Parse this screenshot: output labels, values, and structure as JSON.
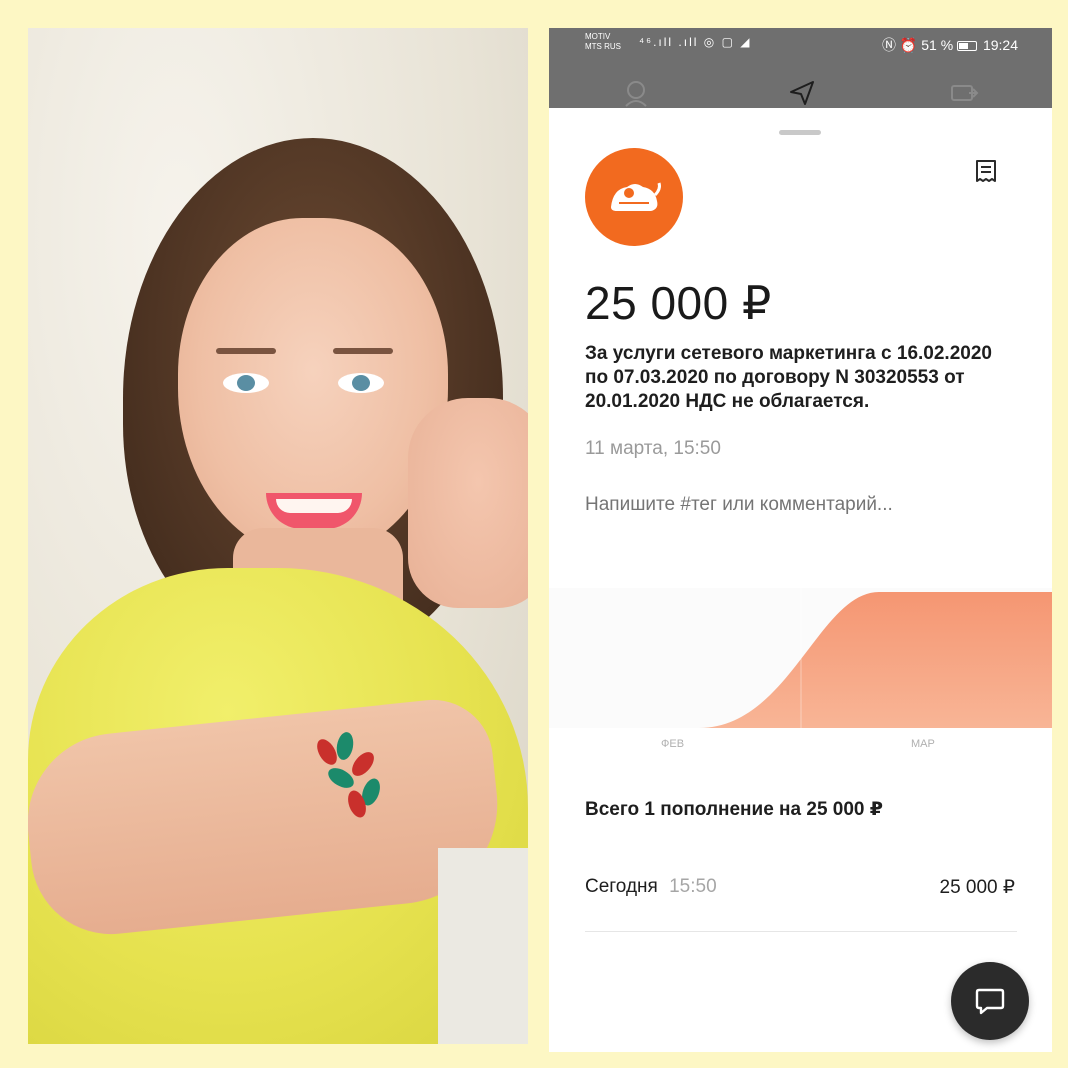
{
  "photo": {
    "alt_subject": "portrait"
  },
  "statusbar": {
    "carrier_top": "MOTIV",
    "carrier_bottom": "MTS RUS",
    "signal_text": "⁴⁶.ıll .ıll",
    "battery": "51 %",
    "time": "19:24"
  },
  "transaction": {
    "amount": "25 000 ₽",
    "description": "За услуги сетевого маркетинга с 16.02.2020 по 07.03.2020 по договору N 30320553 от 20.01.2020 НДС не облагается.",
    "date": "11 марта, 15:50",
    "comment_placeholder": "Напишите #тег или комментарий..."
  },
  "chart_data": {
    "type": "area",
    "categories": [
      "ФЕВ",
      "МАР"
    ],
    "values": [
      0,
      25000
    ],
    "title": "",
    "xlabel": "",
    "ylabel": ""
  },
  "summary": {
    "text": "Всего 1 пополнение на 25 000 ₽"
  },
  "history": [
    {
      "label": "Сегодня",
      "time": "15:50",
      "amount": "25 000 ₽"
    }
  ],
  "colors": {
    "accent": "#f26a1f",
    "chart_fill": "#f6a07c",
    "statusbar": "#6f6f6f"
  }
}
